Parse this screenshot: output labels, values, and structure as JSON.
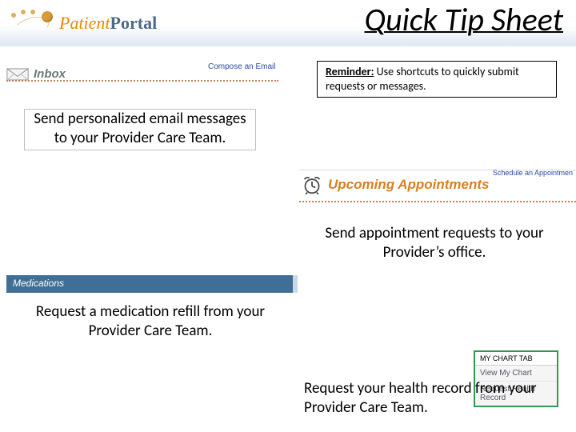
{
  "header": {
    "logo_word1": "Patient",
    "logo_word2": "Portal",
    "title": "Quick Tip Sheet"
  },
  "reminder": {
    "lead": "Reminder:",
    "body": "Use shortcuts to quickly submit requests or messages."
  },
  "inbox": {
    "label": "Inbox",
    "compose_link": "Compose an Email"
  },
  "upcoming": {
    "schedule_link": "Schedule an Appointmen",
    "title": "Upcoming Appointments"
  },
  "medications": {
    "header": "Medications"
  },
  "chart_tab": {
    "heading": "MY CHART TAB",
    "row1": "View My Chart",
    "row2": "Request Health Record"
  },
  "captions": {
    "c1": "Send personalized email messages to your Provider Care Team.",
    "c2": "Send appointment requests to your Provider’s office.",
    "c3": "Request a medication refill from your Provider Care Team.",
    "c4": "Request your health record from your Provider Care Team."
  }
}
